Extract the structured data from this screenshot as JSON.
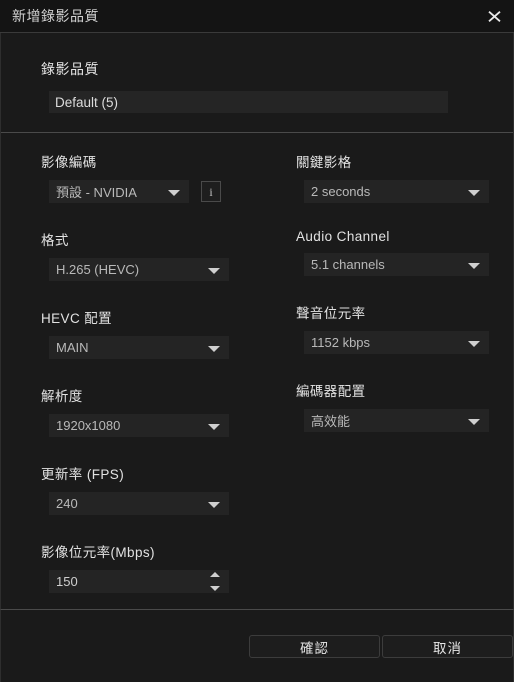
{
  "window": {
    "title": "新增錄影品質",
    "close_icon": "close-x-icon"
  },
  "quality_section": {
    "label": "錄影品質",
    "name_value": "Default (5)",
    "name_placeholder": "Default (5)"
  },
  "left_column": [
    {
      "label": "影像編碼",
      "value": "預設 - NVIDIA",
      "control": "select",
      "has_info": true,
      "info_icon": "info-i-icon"
    },
    {
      "label": "格式",
      "value": "H.265 (HEVC)",
      "control": "select"
    },
    {
      "label": "HEVC 配置",
      "value": "MAIN",
      "control": "select"
    },
    {
      "label": "解析度",
      "value": "1920x1080",
      "control": "select"
    },
    {
      "label": "更新率 (FPS)",
      "value": "240",
      "control": "select"
    },
    {
      "label": "影像位元率(Mbps)",
      "value": "150",
      "control": "spinner"
    }
  ],
  "right_column": [
    {
      "label": "關鍵影格",
      "value": "2 seconds",
      "control": "select"
    },
    {
      "label": "Audio Channel",
      "value": "5.1 channels",
      "control": "select"
    },
    {
      "label": "聲音位元率",
      "value": "1152 kbps",
      "control": "select"
    },
    {
      "label": "編碼器配置",
      "value": "高效能",
      "control": "select"
    }
  ],
  "footer": {
    "confirm_label": "確認",
    "cancel_label": "取消"
  },
  "colors": {
    "window_bg": "#1a1a1a",
    "titlebar_bg": "#141414",
    "field_bg": "#242424",
    "divider": "#4a4a4a",
    "label_text": "#e2e2e2",
    "value_text": "#b9b9b9"
  }
}
